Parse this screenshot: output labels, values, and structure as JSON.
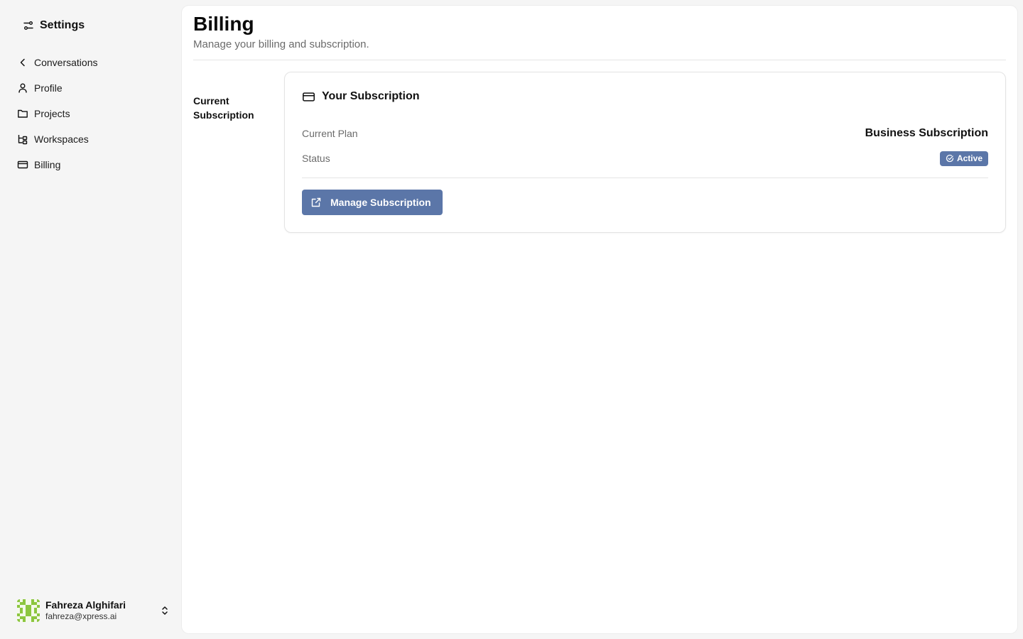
{
  "sidebar": {
    "title": "Settings",
    "title_icon": "sliders-icon",
    "items": [
      {
        "label": "Conversations",
        "icon": "chevron-left-icon"
      },
      {
        "label": "Profile",
        "icon": "user-icon"
      },
      {
        "label": "Projects",
        "icon": "folder-icon"
      },
      {
        "label": "Workspaces",
        "icon": "workspaces-icon"
      },
      {
        "label": "Billing",
        "icon": "credit-card-icon"
      }
    ],
    "user": {
      "name": "Fahreza Alghifari",
      "email": "fahreza@xpress.ai"
    }
  },
  "page": {
    "title": "Billing",
    "subtitle": "Manage your billing and subscription."
  },
  "section": {
    "label": "Current Subscription"
  },
  "card": {
    "title": "Your Subscription",
    "current_plan_label": "Current Plan",
    "current_plan_value": "Business Subscription",
    "status_label": "Status",
    "status_value": "Active",
    "button_label": "Manage Subscription"
  },
  "colors": {
    "accent": "#5b76a8",
    "background": "#f5f5f5",
    "panel": "#ffffff",
    "avatar_green": "#8cc63f"
  }
}
